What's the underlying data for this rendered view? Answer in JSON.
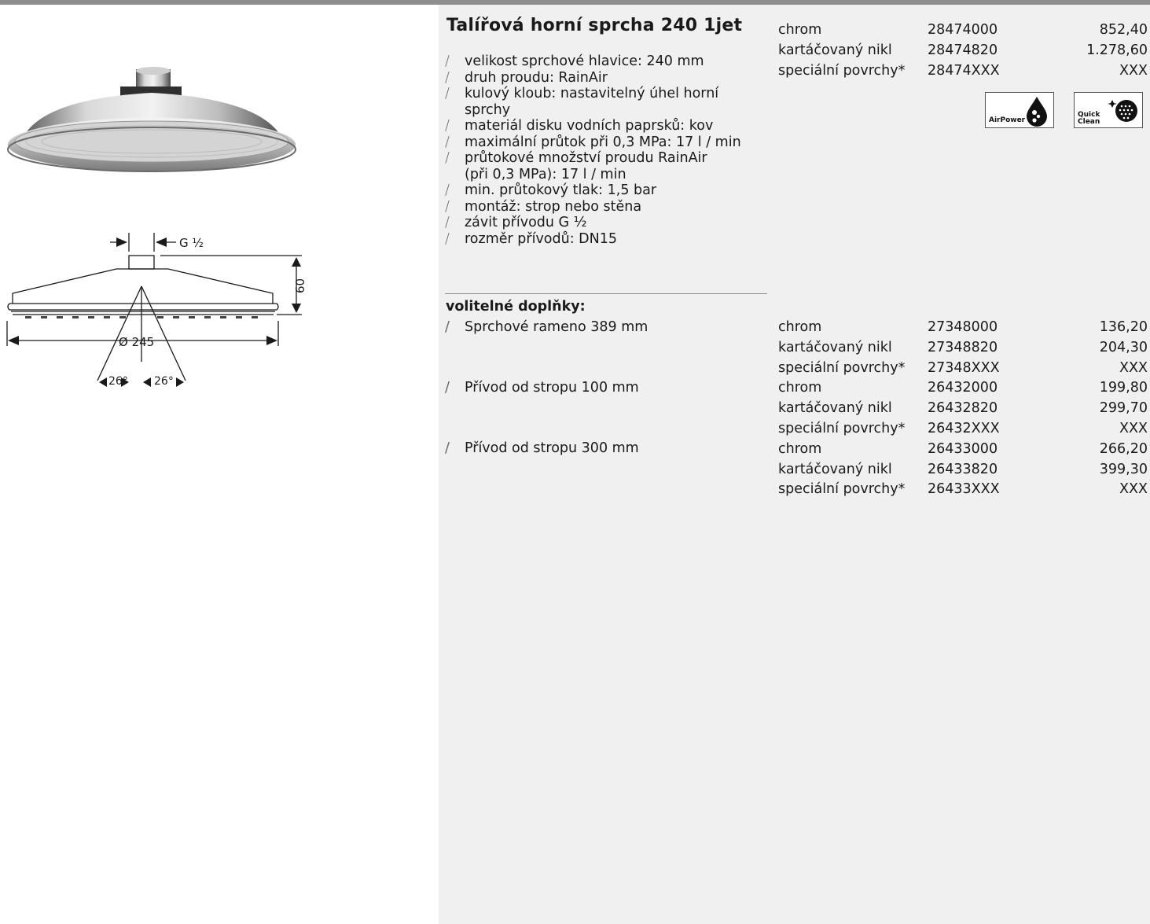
{
  "product": {
    "title": "Talířová horní sprcha 240 1jet",
    "specs": [
      "velikost sprchové hlavice: 240 mm",
      "druh proudu: RainAir",
      "kulový kloub: nastavitelný úhel horní",
      "sprchy",
      "materiál disku vodních paprsků: kov",
      "maximální průtok při 0,3 MPa: 17 l / min",
      "průtokové množství proudu RainAir",
      "(při 0,3 MPa): 17 l / min",
      "min. průtokový tlak: 1,5 bar",
      "montáž: strop nebo stěna",
      "závit přívodu G ½",
      "rozměr přívodů: DN15"
    ],
    "variants": [
      {
        "finish": "chrom",
        "code": "28474000",
        "price": "852,40"
      },
      {
        "finish": "kartáčovaný nikl",
        "code": "28474820",
        "price": "1.278,60"
      },
      {
        "finish": "speciální povrchy*",
        "code": "28474XXX",
        "price": "XXX"
      }
    ]
  },
  "badges": {
    "airpower_label": "AirPower",
    "quickclean_line1": "Quick",
    "quickclean_line2": "Clean"
  },
  "drawing": {
    "thread_label": "G ½",
    "height_label": "60",
    "diameter_label": "Ø 245",
    "angle_left": "26°",
    "angle_right": "26°"
  },
  "options": {
    "heading": "volitelné doplňky:",
    "items": [
      {
        "name": "Sprchové rameno 389 mm",
        "variants": [
          {
            "finish": "chrom",
            "code": "27348000",
            "price": "136,20"
          },
          {
            "finish": "kartáčovaný nikl",
            "code": "27348820",
            "price": "204,30"
          },
          {
            "finish": "speciální povrchy*",
            "code": "27348XXX",
            "price": "XXX"
          }
        ]
      },
      {
        "name": "Přívod od stropu 100 mm",
        "variants": [
          {
            "finish": "chrom",
            "code": "26432000",
            "price": "199,80"
          },
          {
            "finish": "kartáčovaný nikl",
            "code": "26432820",
            "price": "299,70"
          },
          {
            "finish": "speciální povrchy*",
            "code": "26432XXX",
            "price": "XXX"
          }
        ]
      },
      {
        "name": "Přívod od stropu 300 mm",
        "variants": [
          {
            "finish": "chrom",
            "code": "26433000",
            "price": "266,20"
          },
          {
            "finish": "kartáčovaný nikl",
            "code": "26433820",
            "price": "399,30"
          },
          {
            "finish": "speciální povrchy*",
            "code": "26433XXX",
            "price": "XXX"
          }
        ]
      }
    ]
  }
}
